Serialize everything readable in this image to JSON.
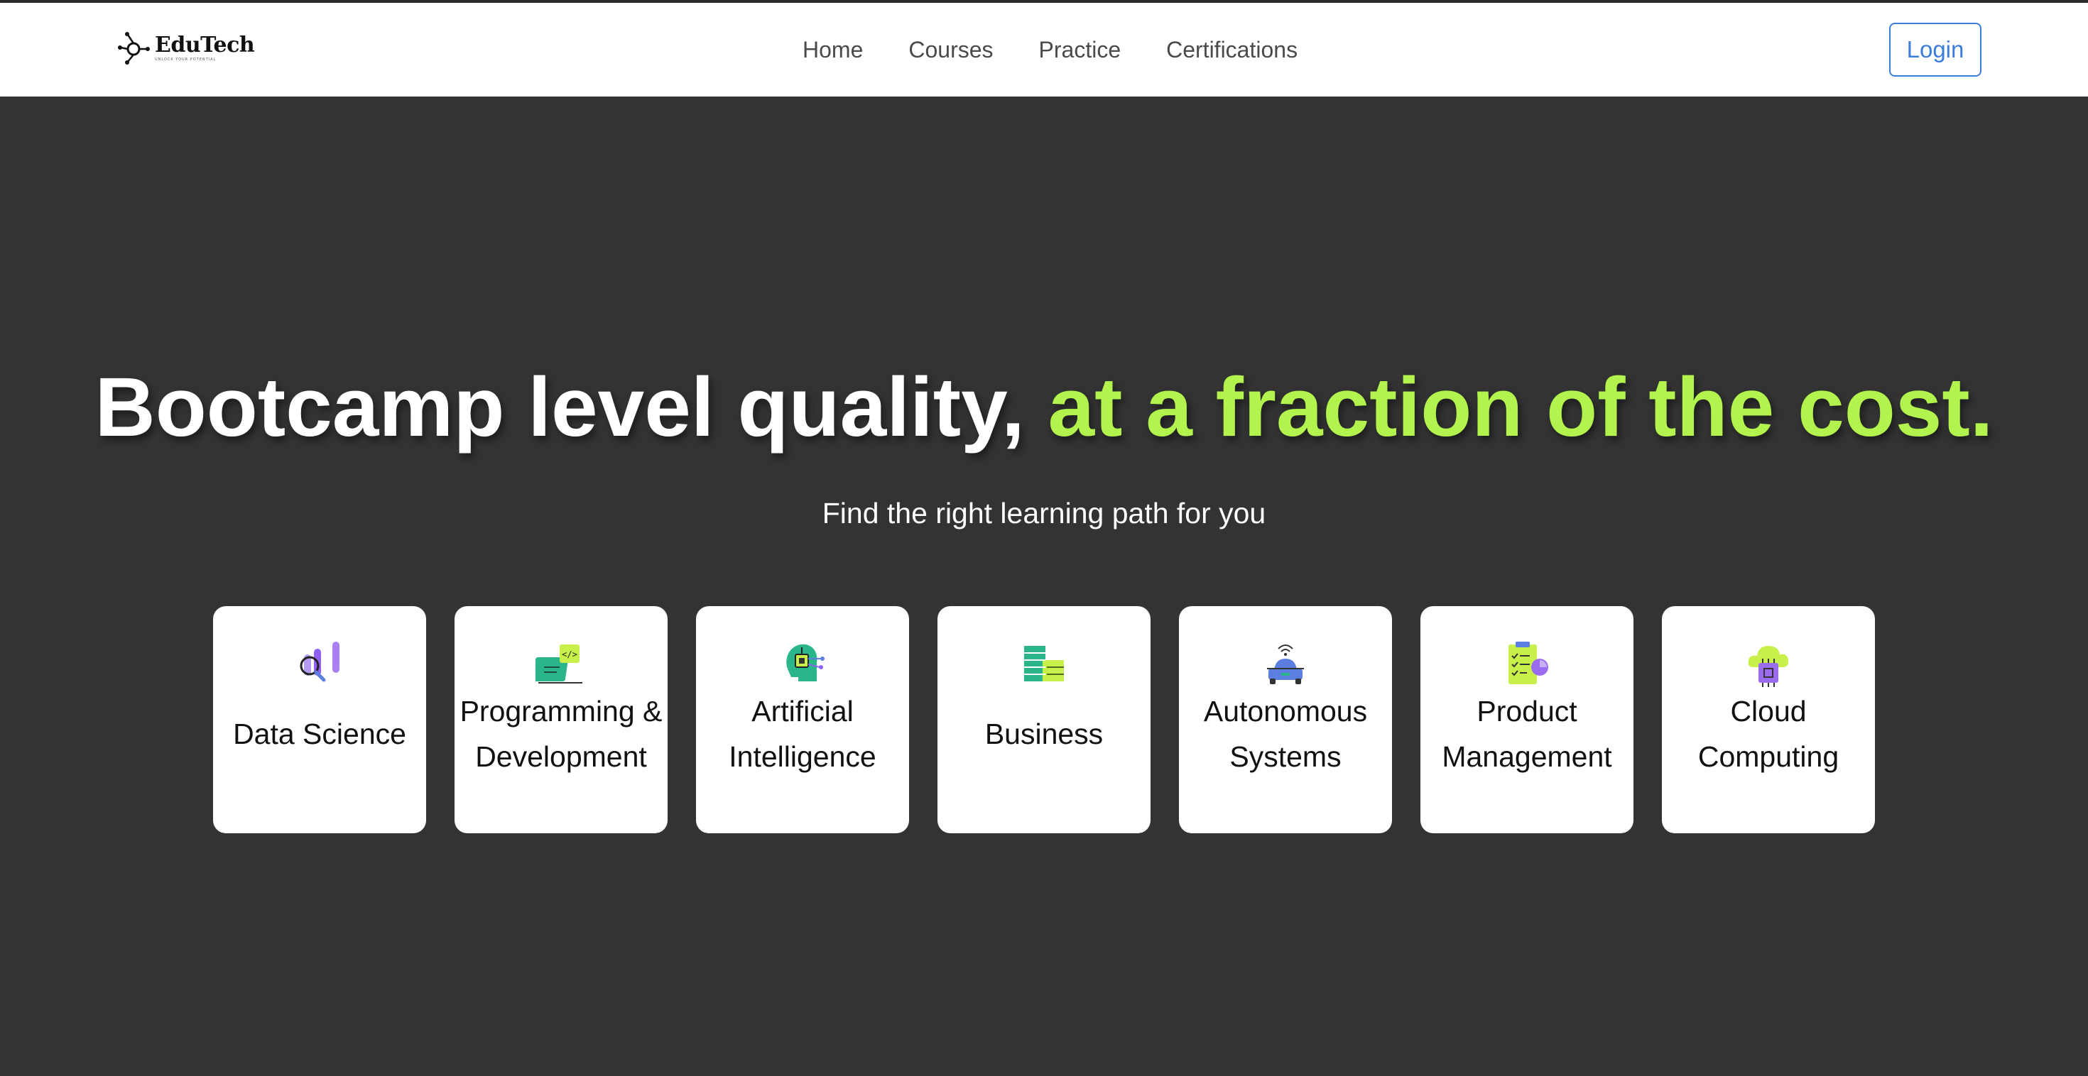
{
  "navbar": {
    "logo_text": "EduTech",
    "logo_tagline": "UNLOCK YOUR POTENTIAL",
    "links": [
      "Home",
      "Courses",
      "Practice",
      "Certifications"
    ],
    "login_label": "Login",
    "login_color": "#3b7ddd"
  },
  "hero": {
    "title_main": "Bootcamp level quality, ",
    "title_accent": "at a fraction of the cost.",
    "accent_color": "#b2f44d",
    "subtitle": "Find the right learning path for you"
  },
  "categories": [
    {
      "label": "Data Science",
      "icon": "data-science-icon"
    },
    {
      "label": "Programming & Development",
      "icon": "programming-icon"
    },
    {
      "label": "Artificial Intelligence",
      "icon": "ai-head-icon"
    },
    {
      "label": "Business",
      "icon": "business-buildings-icon"
    },
    {
      "label": "Autonomous Systems",
      "icon": "autonomous-car-icon"
    },
    {
      "label": "Product Management",
      "icon": "clipboard-checklist-icon"
    },
    {
      "label": "Cloud Computing",
      "icon": "cloud-chip-icon"
    }
  ],
  "colors": {
    "background": "#333333",
    "purple": "#9b6cf0",
    "teal": "#2bb58a",
    "lime": "#c8f04a",
    "blue": "#5b7ee0"
  }
}
